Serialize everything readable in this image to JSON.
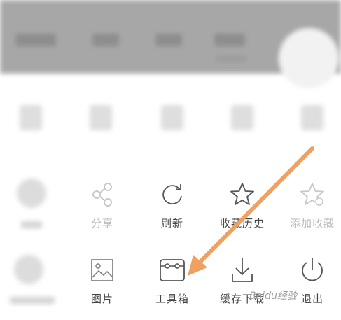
{
  "menu": {
    "row_middle": [
      {
        "id": "share",
        "label": "分享",
        "icon": "share-icon",
        "faded": true
      },
      {
        "id": "refresh",
        "label": "刷新",
        "icon": "refresh-icon",
        "faded": false
      },
      {
        "id": "bookmarks-history",
        "label": "收藏历史",
        "icon": "star-icon",
        "faded": false
      },
      {
        "id": "add-bookmark",
        "label": "添加收藏",
        "icon": "star-add-icon",
        "faded": true
      }
    ],
    "row_bottom": [
      {
        "id": "images",
        "label": "图片",
        "icon": "image-icon",
        "faded": false
      },
      {
        "id": "toolbox",
        "label": "工具箱",
        "icon": "toolbox-icon",
        "faded": false
      },
      {
        "id": "cache-download",
        "label": "缓存下载",
        "icon": "download-icon",
        "faded": false
      },
      {
        "id": "exit",
        "label": "退出",
        "icon": "power-icon",
        "faded": false
      }
    ]
  },
  "annotation": {
    "color": "#f0a060"
  },
  "watermark": {
    "text": "Baidu经验"
  }
}
